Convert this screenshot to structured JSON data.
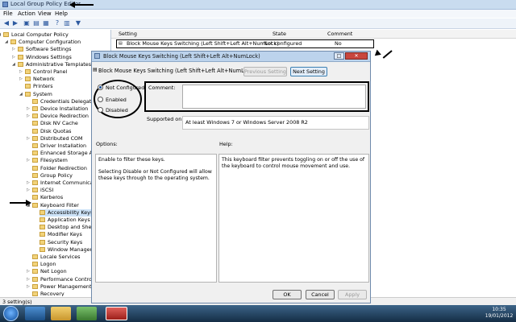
{
  "window": {
    "title": "Local Group Policy Editor"
  },
  "menu": [
    "File",
    "Action",
    "View",
    "Help"
  ],
  "tree": [
    {
      "label": "Local Computer Policy",
      "depth": 0,
      "exp": "◢"
    },
    {
      "label": "Computer Configuration",
      "depth": 1,
      "exp": "◢"
    },
    {
      "label": "Software Settings",
      "depth": 2,
      "exp": "▷"
    },
    {
      "label": "Windows Settings",
      "depth": 2,
      "exp": "▷"
    },
    {
      "label": "Administrative Templates",
      "depth": 2,
      "exp": "◢"
    },
    {
      "label": "Control Panel",
      "depth": 3,
      "exp": "▷"
    },
    {
      "label": "Network",
      "depth": 3,
      "exp": "▷"
    },
    {
      "label": "Printers",
      "depth": 3,
      "exp": ""
    },
    {
      "label": "System",
      "depth": 3,
      "exp": "◢"
    },
    {
      "label": "Credentials Delegation",
      "depth": 4,
      "exp": ""
    },
    {
      "label": "Device Installation",
      "depth": 4,
      "exp": "▷"
    },
    {
      "label": "Device Redirection",
      "depth": 4,
      "exp": "▷"
    },
    {
      "label": "Disk NV Cache",
      "depth": 4,
      "exp": ""
    },
    {
      "label": "Disk Quotas",
      "depth": 4,
      "exp": ""
    },
    {
      "label": "Distributed COM",
      "depth": 4,
      "exp": "▷"
    },
    {
      "label": "Driver Installation",
      "depth": 4,
      "exp": ""
    },
    {
      "label": "Enhanced Storage Access",
      "depth": 4,
      "exp": ""
    },
    {
      "label": "Filesystem",
      "depth": 4,
      "exp": "▷"
    },
    {
      "label": "Folder Redirection",
      "depth": 4,
      "exp": ""
    },
    {
      "label": "Group Policy",
      "depth": 4,
      "exp": ""
    },
    {
      "label": "Internet Communication",
      "depth": 4,
      "exp": "▷"
    },
    {
      "label": "iSCSI",
      "depth": 4,
      "exp": "▷"
    },
    {
      "label": "Kerberos",
      "depth": 4,
      "exp": ""
    },
    {
      "label": "Keyboard Filter",
      "depth": 4,
      "exp": "◢"
    },
    {
      "label": "Accessibility Keys",
      "depth": 5,
      "exp": "",
      "selected": true
    },
    {
      "label": "Application Keys",
      "depth": 5,
      "exp": ""
    },
    {
      "label": "Desktop and Shell Keys",
      "depth": 5,
      "exp": ""
    },
    {
      "label": "Modifier Keys",
      "depth": 5,
      "exp": ""
    },
    {
      "label": "Security Keys",
      "depth": 5,
      "exp": ""
    },
    {
      "label": "Window Management",
      "depth": 5,
      "exp": ""
    },
    {
      "label": "Locale Services",
      "depth": 4,
      "exp": ""
    },
    {
      "label": "Logon",
      "depth": 4,
      "exp": ""
    },
    {
      "label": "Net Logon",
      "depth": 4,
      "exp": "▷"
    },
    {
      "label": "Performance Control Panel",
      "depth": 4,
      "exp": "▷"
    },
    {
      "label": "Power Management",
      "depth": 4,
      "exp": "▷"
    },
    {
      "label": "Recovery",
      "depth": 4,
      "exp": ""
    }
  ],
  "list": {
    "headers": {
      "setting": "Setting",
      "state": "State",
      "comment": "Comment"
    },
    "row": {
      "setting": "Block Mouse Keys Switching (Left Shift+Left Alt+NumLock)",
      "state": "Not configured",
      "comment": "No"
    }
  },
  "status": "3 setting(s)",
  "dialog": {
    "title": "Block Mouse Keys Switching (Left Shift+Left Alt+NumLock)",
    "policy_name": "Block Mouse Keys Switching (Left Shift+Left Alt+NumLock)",
    "prev_label": "Previous Setting",
    "next_label": "Next Setting",
    "radios": [
      "Not Configured",
      "Enabled",
      "Disabled"
    ],
    "selected_radio": "Not Configured",
    "comment_label": "Comment:",
    "supported_label": "Supported on:",
    "supported_value": "At least Windows 7 or Windows Server 2008 R2",
    "options_label": "Options:",
    "help_label": "Help:",
    "options_text": [
      "Enable to filter these keys.",
      "Selecting Disable or Not Configured will allow these keys through to the operating system."
    ],
    "help_text": "This keyboard filter prevents toggling on or off the use of the keyboard to control mouse movement and use.",
    "ok_label": "OK",
    "cancel_label": "Cancel",
    "apply_label": "Apply"
  },
  "clock": {
    "time": "10:35",
    "date": "19/01/2012"
  },
  "colors": {
    "accent": "#1c4e94",
    "taskbar": "#1f3f5c"
  }
}
